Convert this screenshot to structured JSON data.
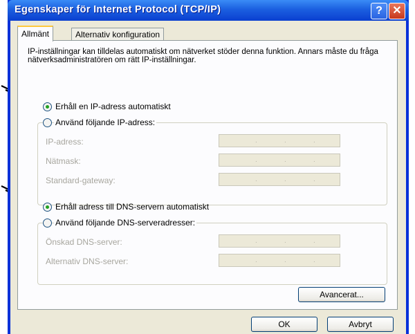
{
  "window": {
    "title": "Egenskaper för Internet Protocol (TCP/IP)",
    "help_glyph": "?",
    "close_glyph": "✕"
  },
  "tabs": [
    {
      "label": "Allmänt",
      "active": true
    },
    {
      "label": "Alternativ konfiguration",
      "active": false
    }
  ],
  "intro_text": "IP-inställningar kan tilldelas automatiskt om nätverket stöder denna funktion. Annars måste du fråga nätverksadministratören om rätt IP-inställningar.",
  "ip": {
    "auto_label": "Erhåll en IP-adress automatiskt",
    "auto_selected": true,
    "manual_label": "Använd följande IP-adress:",
    "fields": [
      {
        "label": "IP-adress:",
        "value": ""
      },
      {
        "label": "Nätmask:",
        "value": ""
      },
      {
        "label": "Standard-gateway:",
        "value": ""
      }
    ]
  },
  "dns": {
    "auto_label": "Erhåll adress till DNS-servern automatiskt",
    "auto_selected": true,
    "manual_label": "Använd följande DNS-serveradresser:",
    "fields": [
      {
        "label": "Önskad DNS-server:",
        "value": ""
      },
      {
        "label": "Alternativ DNS-server:",
        "value": ""
      }
    ]
  },
  "buttons": {
    "advanced": "Avancerat...",
    "ok": "OK",
    "cancel": "Avbryt"
  },
  "colors": {
    "titlebar": "#0a3fd0",
    "radio_dot": "#21a121",
    "dialog_bg": "#ece9d8"
  }
}
